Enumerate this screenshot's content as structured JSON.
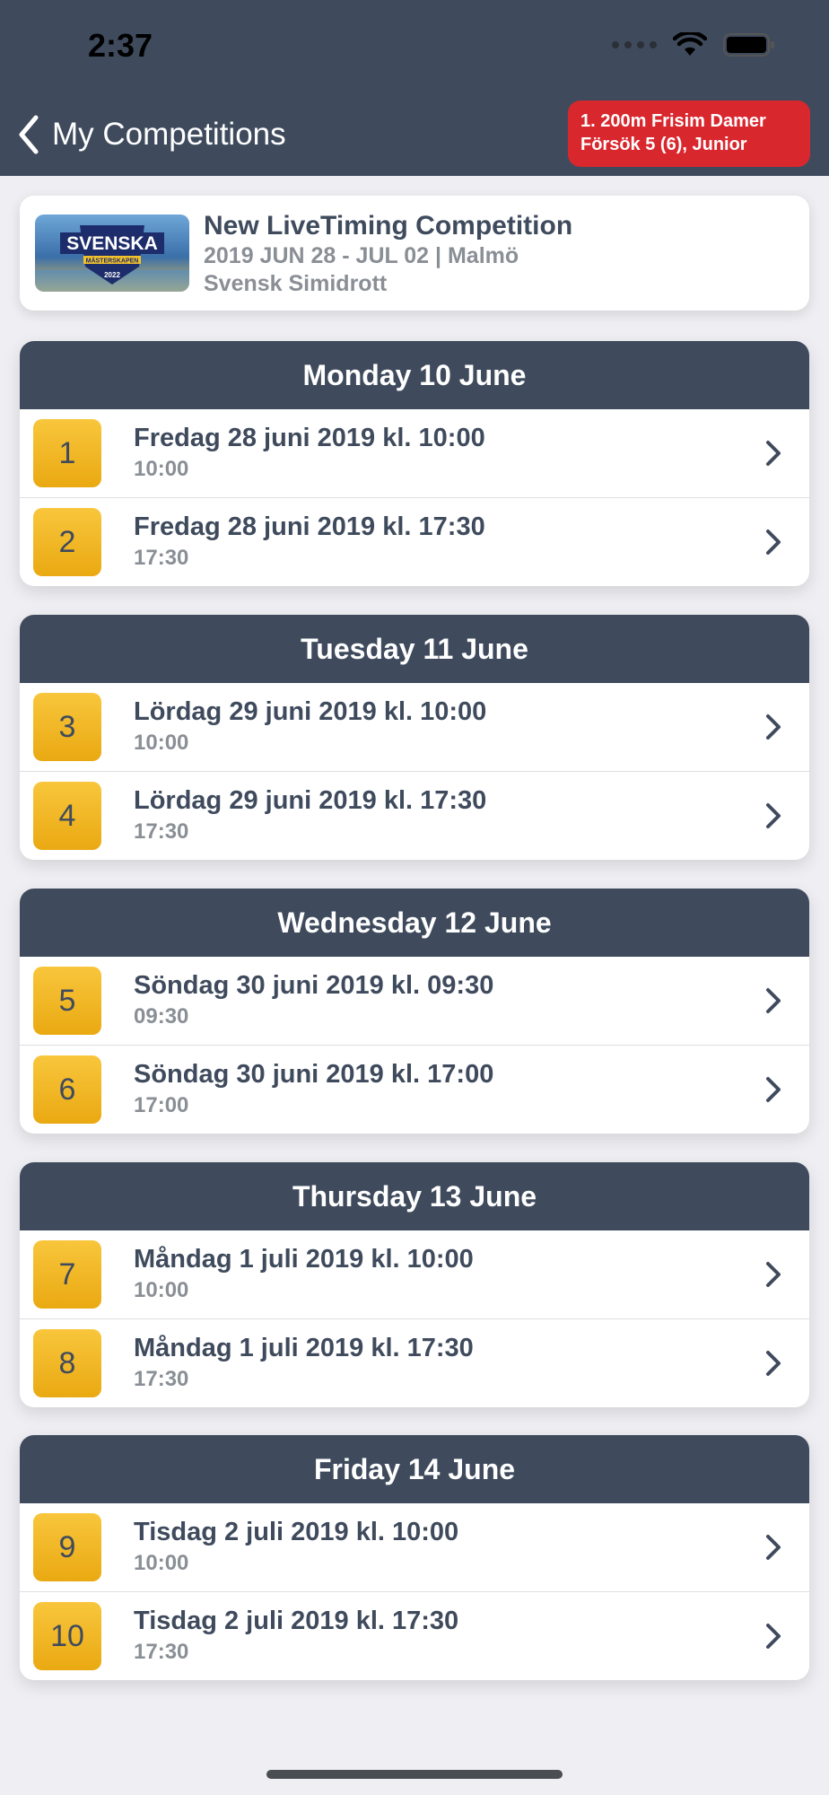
{
  "status_bar": {
    "time": "2:37"
  },
  "nav": {
    "back_label": "My Competitions",
    "live_badge": {
      "line1": "1. 200m Frisim Damer",
      "line2": "Försök 5 (6), Junior"
    }
  },
  "competition": {
    "title": "New LiveTiming Competition",
    "dates_location": "2019 JUN 28 - JUL 02 | Malmö",
    "organizer": "Svensk Simidrott",
    "logo_text": "SVENSKA",
    "logo_subtext": "MÄSTERSKAPEN",
    "logo_year": "2022"
  },
  "days": [
    {
      "header": "Monday 10 June",
      "sessions": [
        {
          "number": "1",
          "title": "Fredag 28 juni 2019 kl. 10:00",
          "time": "10:00"
        },
        {
          "number": "2",
          "title": "Fredag 28 juni 2019 kl. 17:30",
          "time": "17:30"
        }
      ]
    },
    {
      "header": "Tuesday 11 June",
      "sessions": [
        {
          "number": "3",
          "title": "Lördag 29 juni 2019 kl. 10:00",
          "time": "10:00"
        },
        {
          "number": "4",
          "title": "Lördag 29 juni 2019 kl. 17:30",
          "time": "17:30"
        }
      ]
    },
    {
      "header": "Wednesday 12 June",
      "sessions": [
        {
          "number": "5",
          "title": "Söndag 30 juni 2019 kl. 09:30",
          "time": "09:30"
        },
        {
          "number": "6",
          "title": "Söndag 30 juni 2019 kl. 17:00",
          "time": "17:00"
        }
      ]
    },
    {
      "header": "Thursday 13 June",
      "sessions": [
        {
          "number": "7",
          "title": "Måndag 1 juli 2019 kl. 10:00",
          "time": "10:00"
        },
        {
          "number": "8",
          "title": "Måndag 1 juli 2019 kl. 17:30",
          "time": "17:30"
        }
      ]
    },
    {
      "header": "Friday 14 June",
      "sessions": [
        {
          "number": "9",
          "title": "Tisdag 2 juli 2019 kl. 10:00",
          "time": "10:00"
        },
        {
          "number": "10",
          "title": "Tisdag 2 juli 2019 kl. 17:30",
          "time": "17:30"
        }
      ]
    }
  ],
  "colors": {
    "header_bg": "#3f4b5d",
    "badge_red": "#d9272e",
    "number_badge": "#f3b829",
    "text_primary": "#3f4b5d",
    "text_secondary": "#8a8f96",
    "background": "#efeff3"
  },
  "icons": {
    "back": "chevron-left-icon",
    "row": "chevron-right-icon",
    "wifi": "wifi-icon",
    "battery": "battery-icon"
  }
}
